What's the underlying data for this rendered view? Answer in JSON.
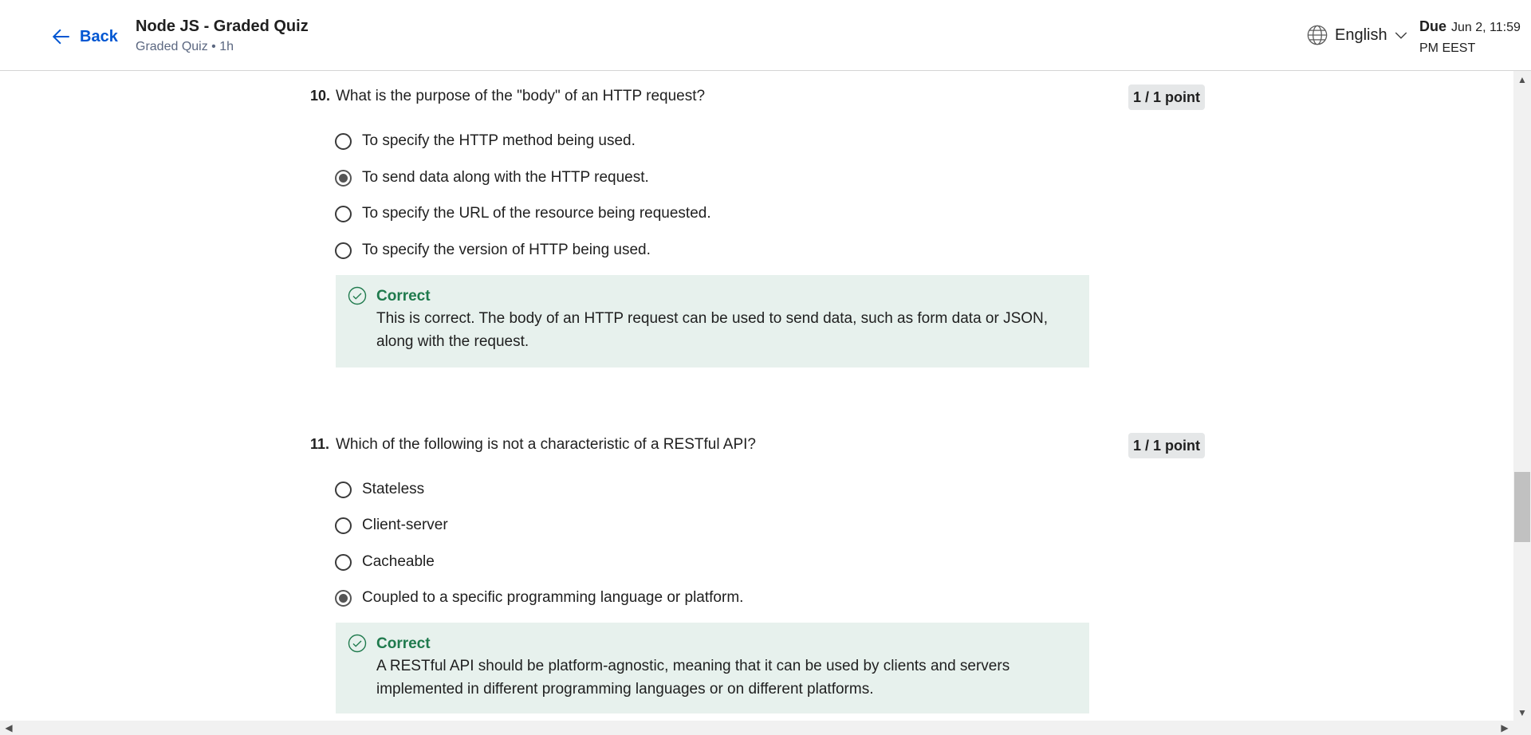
{
  "header": {
    "back_label": "Back",
    "title": "Node JS - Graded Quiz",
    "subtitle": "Graded Quiz • 1h",
    "language": "English",
    "due_label": "Due",
    "due_date_line1": "Jun 2, 11:59",
    "due_date_line2": "PM EEST"
  },
  "questions": [
    {
      "number": "10.",
      "text": "What is the purpose of the \"body\" of an HTTP request?",
      "points": "1 / 1 point",
      "options": [
        {
          "label": "To specify the HTTP method being used.",
          "selected": false
        },
        {
          "label": "To send data along with the HTTP request.",
          "selected": true
        },
        {
          "label": "To specify the URL of the resource being requested.",
          "selected": false
        },
        {
          "label": "To specify the version of HTTP being used.",
          "selected": false
        }
      ],
      "feedback": {
        "status": "Correct",
        "text": "This is correct. The body of an HTTP request can be used to send data, such as form data or JSON, along with the request."
      }
    },
    {
      "number": "11.",
      "text": "Which of the following is not a characteristic of a RESTful API?",
      "points": "1 / 1 point",
      "options": [
        {
          "label": "Stateless",
          "selected": false
        },
        {
          "label": "Client-server",
          "selected": false
        },
        {
          "label": "Cacheable",
          "selected": false
        },
        {
          "label": "Coupled to a specific programming language or platform.",
          "selected": true
        }
      ],
      "feedback": {
        "status": "Correct",
        "text": "A RESTful API should be platform-agnostic, meaning that it can be used by clients and servers implemented in different programming languages or on different platforms."
      }
    }
  ],
  "colors": {
    "accent": "#0056d2",
    "correct_green": "#1f7a4d",
    "feedback_bg": "#e7f1ed"
  }
}
